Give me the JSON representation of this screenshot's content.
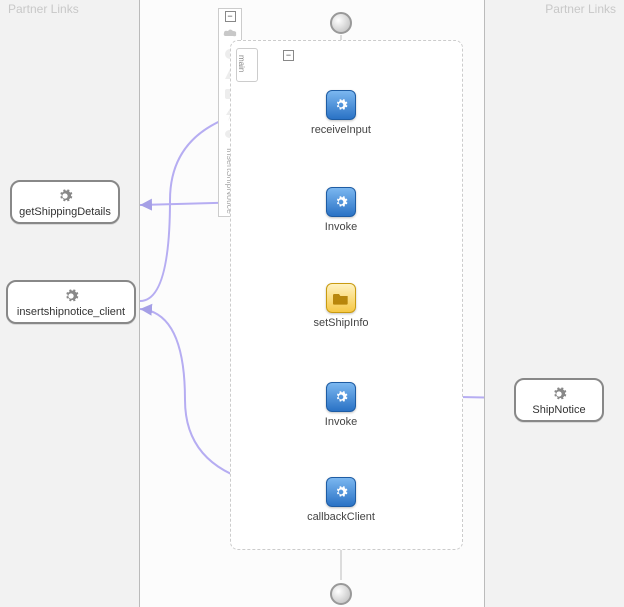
{
  "panes": {
    "left_title": "Partner Links",
    "right_title": "Partner Links"
  },
  "partners": {
    "getShippingDetails": "getShippingDetails",
    "insertshipnotice_client": "insertshipnotice_client",
    "shipNotice": "ShipNotice"
  },
  "nodes": {
    "receiveInput": "receiveInput",
    "invoke1": "Invoke",
    "setShipInfo": "setShipInfo",
    "invoke2": "Invoke",
    "callbackClient": "callbackClient"
  },
  "tab": {
    "main": "main"
  },
  "toolbar": {
    "label": "InsertShipNotice"
  },
  "glyph": {
    "minus": "−"
  }
}
